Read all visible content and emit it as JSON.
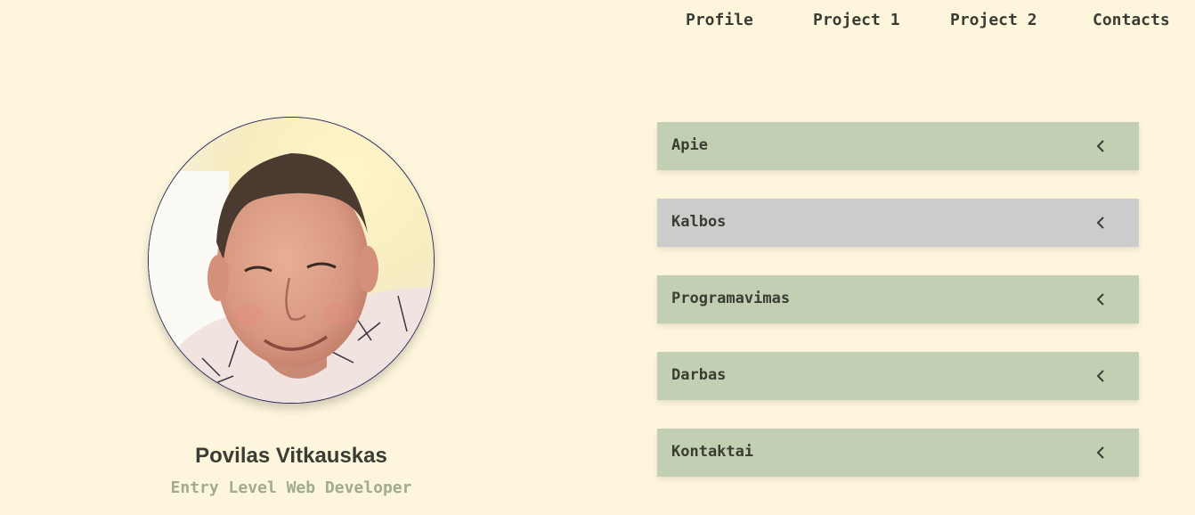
{
  "nav": {
    "items": [
      {
        "label": "Profile"
      },
      {
        "label": "Project 1"
      },
      {
        "label": "Project 2"
      },
      {
        "label": "Contacts"
      }
    ]
  },
  "profile": {
    "avatar_icon": "profile-photo",
    "name": "Povilas Vitkauskas",
    "role": "Entry Level Web Developer"
  },
  "accordion": {
    "items": [
      {
        "label": "Apie",
        "icon": "chevron-left-icon",
        "active": false
      },
      {
        "label": "Kalbos",
        "icon": "chevron-left-icon",
        "active": true
      },
      {
        "label": "Programavimas",
        "icon": "chevron-left-icon",
        "active": false
      },
      {
        "label": "Darbas",
        "icon": "chevron-left-icon",
        "active": false
      },
      {
        "label": "Kontaktai",
        "icon": "chevron-left-icon",
        "active": false
      }
    ]
  },
  "colors": {
    "background": "#fef6dc",
    "accordion_bg": "#c2cfb2",
    "accordion_active_bg": "#cccccc",
    "text": "#3a3d33",
    "role_text": "#a0ab90"
  }
}
